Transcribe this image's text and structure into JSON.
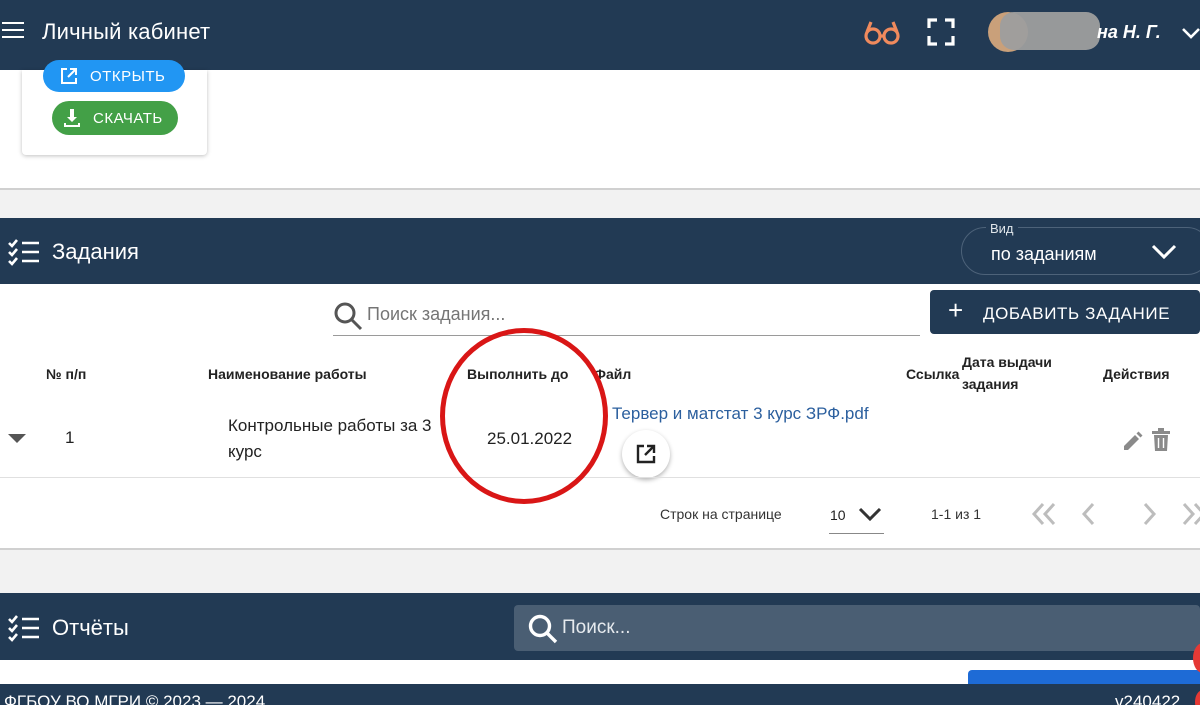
{
  "header": {
    "title": "Личный кабинет",
    "user_name": "на Н. Г.",
    "icons": [
      "menu-icon",
      "glasses-icon",
      "fullscreen-icon",
      "avatar",
      "chevron-down-icon"
    ]
  },
  "file_card": {
    "open_label": "ОТКРЫТЬ",
    "download_label": "СКАЧАТЬ"
  },
  "tasks": {
    "title": "Задания",
    "view_legend": "Вид",
    "view_value": "по заданиям",
    "search_placeholder": "Поиск задания...",
    "add_button": "ДОБАВИТЬ ЗАДАНИЕ",
    "columns": {
      "num": "№ п/п",
      "name": "Наименование работы",
      "due": "Выполнить до",
      "file": "Файл",
      "link": "Ссылка",
      "issued_l1": "Дата выдачи",
      "issued_l2": "задания",
      "actions": "Действия"
    },
    "rows": [
      {
        "num": "1",
        "name_l1": "Контрольные работы за 3",
        "name_l2": "курс",
        "due": "25.01.2022",
        "file": "Тервер и матстат 3 курс ЗРФ.pdf",
        "link": "",
        "issued": ""
      }
    ],
    "pagination": {
      "rows_label": "Строк на странице",
      "rows_per_page": "10",
      "range": "1-1 из 1"
    }
  },
  "reports": {
    "title": "Отчёты",
    "search_placeholder": "Поиск..."
  },
  "footer": {
    "left": "ФГБОУ ВО МГРИ © 2023 — 2024",
    "right": "v240422"
  },
  "colors": {
    "navy": "#223a54",
    "open_button": "#2196f3",
    "download_button": "#43a047",
    "link": "#2b5f9e",
    "annotation_red": "#d91616"
  }
}
